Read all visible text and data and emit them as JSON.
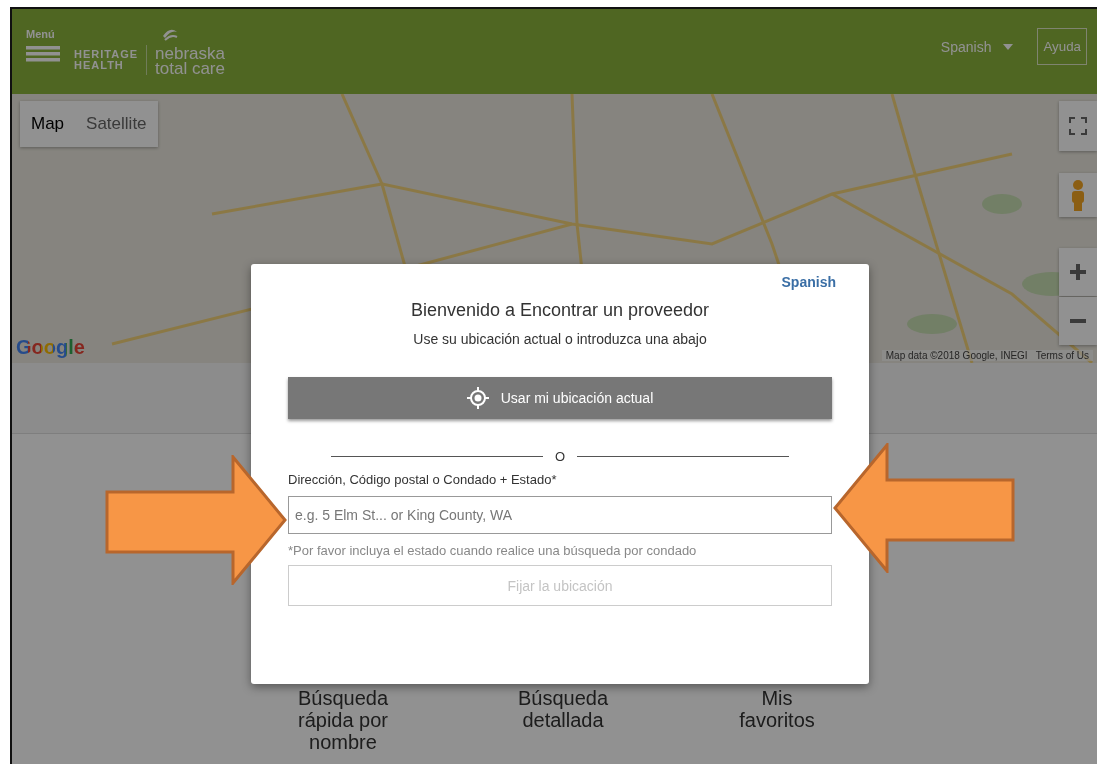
{
  "header": {
    "menu_label": "Menú",
    "logo_primary": [
      "HERITAGE",
      "HEALTH"
    ],
    "logo_secondary": [
      "nebraska",
      "total care"
    ],
    "language": "Spanish",
    "help": "Ayuda"
  },
  "map": {
    "type_buttons": [
      {
        "label": "Map",
        "selected": true
      },
      {
        "label": "Satellite",
        "selected": false
      }
    ],
    "logo": "Google",
    "attribution": "Map data ©2018 Google, INEGI",
    "terms": "Terms of Us"
  },
  "modal": {
    "language": "Spanish",
    "title": "Bienvenido a Encontrar un proveedor",
    "subtitle": "Use su ubicación actual o introduzca una abajo",
    "locate_button": "Usar mi ubicación actual",
    "divider": "O",
    "field_label": "Dirección, Código postal o Condado + Estado*",
    "placeholder": "e.g. 5 Elm St... or King County, WA",
    "hint": "*Por favor incluya el estado cuando realice una búsqueda por condado",
    "set_button": {
      "label": "Fijar la ubicación",
      "disabled": true
    }
  },
  "tiles": [
    "Búsqueda rápida por nombre",
    "Búsqueda detallada",
    "Mis favoritos"
  ]
}
